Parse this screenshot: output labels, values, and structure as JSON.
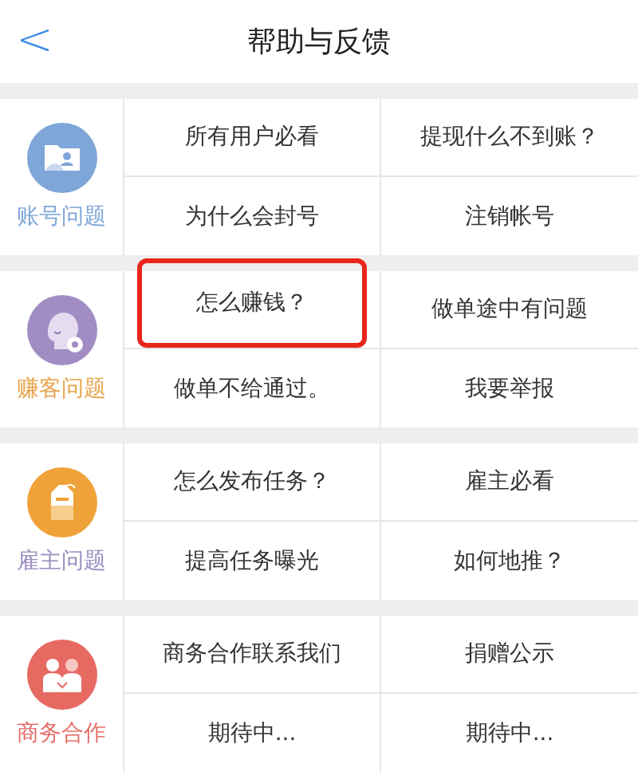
{
  "header": {
    "back": "<",
    "title": "帮助与反馈"
  },
  "sections": [
    {
      "label": "账号问题",
      "color": "#7fa6d8",
      "kind": "account",
      "items": [
        {
          "text": "所有用户必看",
          "highlighted": false
        },
        {
          "text": "提现什么不到账？",
          "highlighted": false
        },
        {
          "text": "为什么会封号",
          "highlighted": false
        },
        {
          "text": "注销帐号",
          "highlighted": false
        }
      ]
    },
    {
      "label": "赚客问题",
      "color": "#e8a34a",
      "kind": "earner",
      "items": [
        {
          "text": "怎么赚钱？",
          "highlighted": true
        },
        {
          "text": "做单途中有问题",
          "highlighted": false
        },
        {
          "text": "做单不给通过。",
          "highlighted": false
        },
        {
          "text": "我要举报",
          "highlighted": false
        }
      ]
    },
    {
      "label": "雇主问题",
      "color": "#9a8cc0",
      "kind": "employer",
      "items": [
        {
          "text": "怎么发布任务？",
          "highlighted": false
        },
        {
          "text": "雇主必看",
          "highlighted": false
        },
        {
          "text": "提高任务曝光",
          "highlighted": false
        },
        {
          "text": "如何地推？",
          "highlighted": false
        }
      ]
    },
    {
      "label": "商务合作",
      "color": "#e5706a",
      "kind": "business",
      "items": [
        {
          "text": "商务合作联系我们",
          "highlighted": false
        },
        {
          "text": "捐赠公示",
          "highlighted": false
        },
        {
          "text": "期待中...",
          "highlighted": false
        },
        {
          "text": "期待中...",
          "highlighted": false
        }
      ]
    }
  ]
}
